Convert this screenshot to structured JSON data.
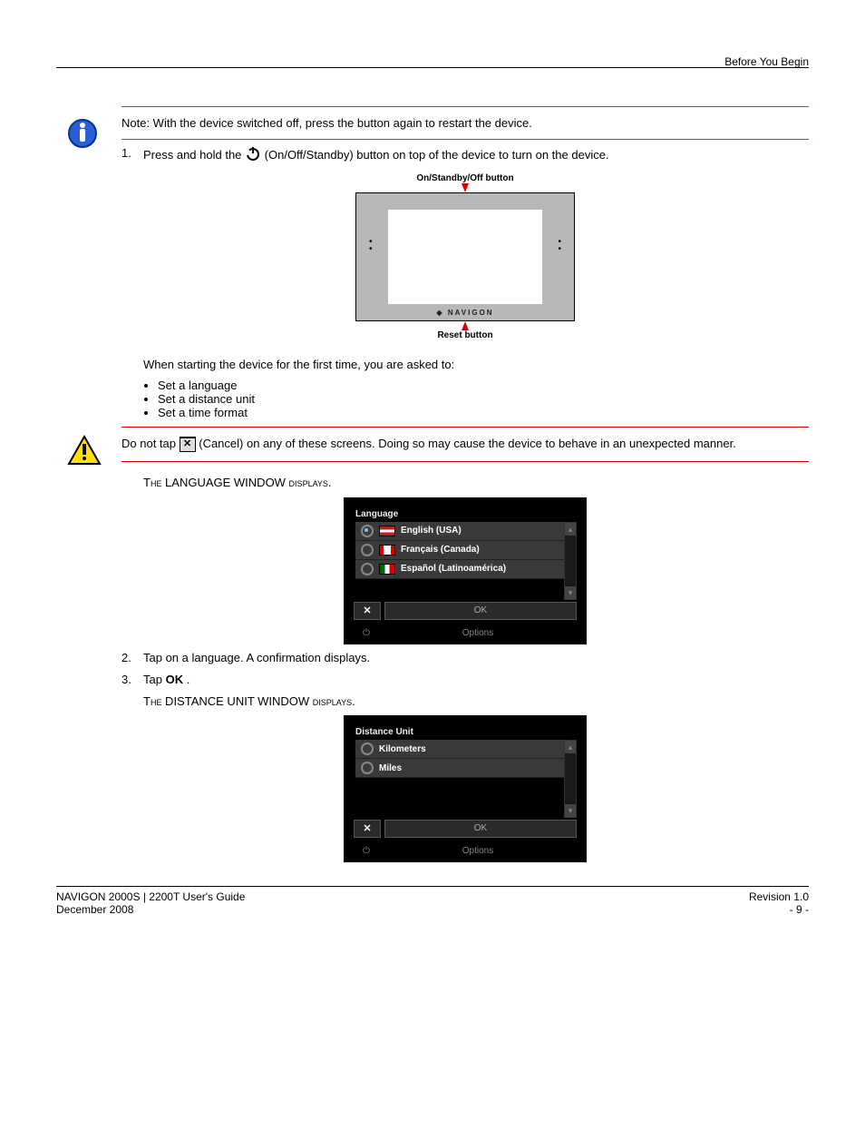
{
  "header": {
    "right": "Before You Begin"
  },
  "note": {
    "text": "Note: With the device switched off, press the button again to restart the device."
  },
  "step1": {
    "num": "1.",
    "text_before": "Press and hold the ",
    "icon_name": "power-icon",
    "text_after": " (On/Off/Standby) button on top of the device to turn on the device."
  },
  "figure": {
    "top_label": "On/Standby/Off button",
    "brand_diamond": "◆",
    "brand_text": "NAVIGON",
    "bottom_label": "Reset button"
  },
  "first_time_para": "When starting the device for the first time, you are asked to:",
  "bullets": {
    "lang": "Set a language",
    "dist": "Set a distance unit",
    "time": "Set a time format"
  },
  "caution": {
    "before": "Do not tap ",
    "after": "(Cancel) on any of these screens. Doing so may cause the device to behave in an unexpected manner."
  },
  "lang_window": {
    "title": "The LANGUAGE WINDOW displays."
  },
  "ss1": {
    "title": "Language",
    "opts": {
      "en": "English (USA)",
      "fr": "Français (Canada)",
      "es": "Español (Latinoamérica)"
    },
    "ok": "OK",
    "cancel_glyph": "✕",
    "options": "Options",
    "power_glyph": "⏻",
    "scroll_up": "▴",
    "scroll_down": "▾"
  },
  "step2": {
    "num": "2.",
    "text": "Tap on a language. A confirmation displays."
  },
  "step3": {
    "num": "3.",
    "text_before": "Tap ",
    "ok": "OK",
    "text_after": "."
  },
  "dist_window": {
    "title": "The DISTANCE UNIT WINDOW displays."
  },
  "ss2": {
    "title": "Distance Unit",
    "opts": {
      "km": "Kilometers",
      "mi": "Miles"
    },
    "ok": "OK",
    "cancel_glyph": "✕",
    "options": "Options",
    "power_glyph": "⏻",
    "scroll_up": "▴",
    "scroll_down": "▾"
  },
  "footer": {
    "left_title": "NAVIGON 2000S | 2200T User's Guide",
    "left_sub": "December 2008",
    "right_revision": "Revision 1.0",
    "right_page": "- 9 -"
  }
}
